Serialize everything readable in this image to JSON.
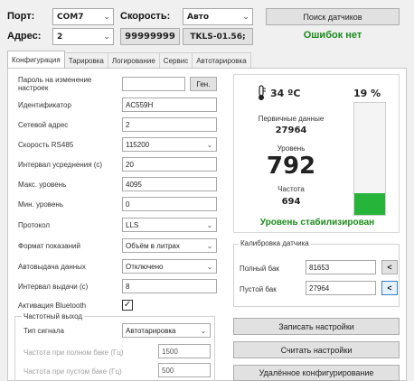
{
  "top": {
    "port_label": "Порт:",
    "port_value": "COM7",
    "speed_label": "Скорость:",
    "speed_value": "Авто",
    "search_button": "Поиск датчиков",
    "address_label": "Адрес:",
    "address_value": "2",
    "serial_number": "99999999",
    "firmware": "TKLS-01.56;",
    "errors_status": "Ошибок нет"
  },
  "tabs": [
    "Конфигурация",
    "Тарировка",
    "Логирование",
    "Сервис",
    "Автотарировка"
  ],
  "config": {
    "rows": [
      {
        "label": "Пароль на изменение настроек",
        "value": "",
        "button": "Ген."
      },
      {
        "label": "Идентификатор",
        "value": "AC559H"
      },
      {
        "label": "Сетевой адрес",
        "value": "2"
      },
      {
        "label": "Скорость RS485",
        "value": "115200",
        "dropdown": true
      },
      {
        "label": "Интервал усреднения (с)",
        "value": "20"
      },
      {
        "label": "Макс. уровень",
        "value": "4095"
      },
      {
        "label": "Мин. уровень",
        "value": "0"
      },
      {
        "label": "Протокол",
        "value": "LLS",
        "dropdown": true
      },
      {
        "label": "Формат показаний",
        "value": "Объём в литрах",
        "dropdown": true
      },
      {
        "label": "Автовыдача данных",
        "value": "Отключено",
        "dropdown": true
      },
      {
        "label": "Интервал выдачи (с)",
        "value": "8"
      },
      {
        "label": "Активация Bluetooth",
        "checked": true
      }
    ],
    "freq_output": {
      "group_label": "Частотный выход",
      "signal_type_label": "Тип сигнала",
      "signal_type_value": "Автотарировка",
      "full_freq_label": "Частота при полном баке (Гц)",
      "full_freq_value": "1500",
      "empty_freq_label": "Частота при пустом баке (Гц)",
      "empty_freq_value": "500"
    }
  },
  "status": {
    "temperature": "34 ºC",
    "percent": "19 %",
    "level_fill_fraction": 0.19,
    "primary_label": "Первичные данные",
    "primary_value": "27964",
    "level_label": "Уровень",
    "level_value": "792",
    "freq_label": "Частота",
    "freq_value": "694",
    "stabilized": "Уровень стабилизирован"
  },
  "calibration": {
    "group_label": "Калибровка датчика",
    "full_label": "Полный бак",
    "full_value": "81653",
    "empty_label": "Пустой бак",
    "empty_value": "27964",
    "arrow_button": "<"
  },
  "actions": {
    "write": "Записать настройки",
    "read": "Считать настройки",
    "remote": "Удалённое конфигурирование"
  },
  "colors": {
    "accent_green": "#1a8a1a",
    "level_bar_green": "#27b43a"
  }
}
